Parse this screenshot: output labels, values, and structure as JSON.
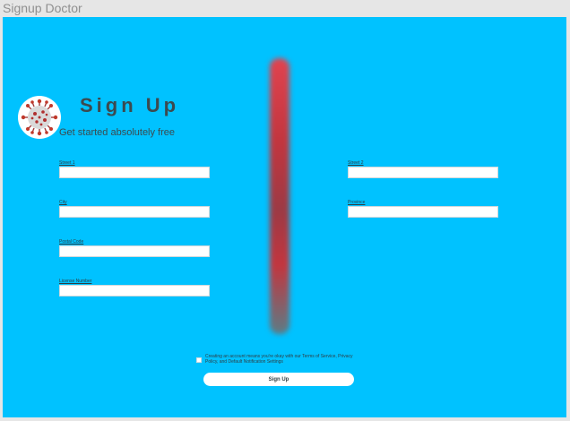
{
  "window": {
    "title": "Signup Doctor"
  },
  "form": {
    "title": "Sign Up",
    "subtitle": "Get started absolutely free",
    "fields": {
      "street1": {
        "label": "Street 1",
        "value": ""
      },
      "street2": {
        "label": "Street 2",
        "value": ""
      },
      "city": {
        "label": "City",
        "value": ""
      },
      "province": {
        "label": "Province",
        "value": ""
      },
      "postal_code": {
        "label": "Postal Code",
        "value": ""
      },
      "license_number": {
        "label": "License Number",
        "value": ""
      }
    },
    "terms_text": "Creating an account means you're okay with our Terms of Service, Privacy Policy, and Default Notification Settings",
    "submit_label": "Sign Up"
  },
  "colors": {
    "background": "#00c2ff",
    "heading": "#3c4a4f",
    "divider_accent": "#c2363f"
  },
  "icons": {
    "logo": "coronavirus-icon"
  }
}
